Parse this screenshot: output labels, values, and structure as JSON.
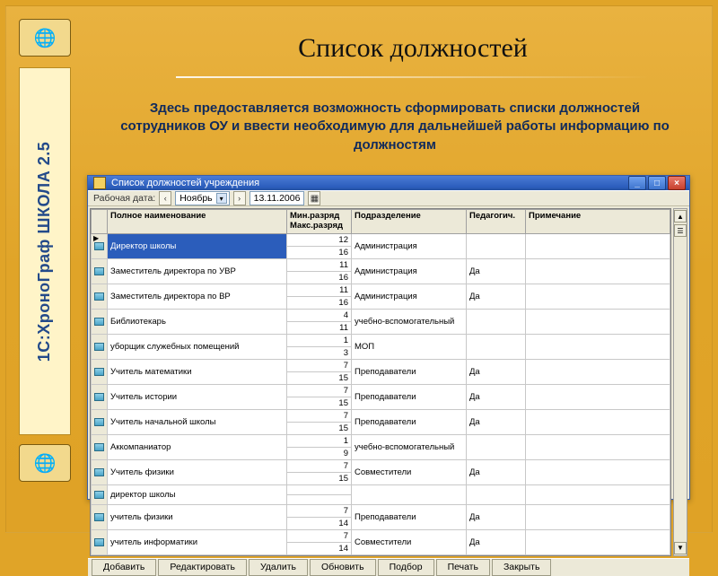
{
  "slide": {
    "title": "Список должностей",
    "description": "Здесь предоставляется возможность сформировать списки должностей сотрудников ОУ и ввести необходимую для дальнейшей работы информацию по должностям",
    "product_vertical": "1С:ХроноГраф ШКОЛА 2.5"
  },
  "app": {
    "window_title": "Список должностей учреждения",
    "toolbar": {
      "work_date_label": "Рабочая дата:",
      "month_value": "Ноябрь",
      "date_value": "13.11.2006"
    },
    "columns": {
      "name": "Полное наименование",
      "rank": "Мин.разряд\nМакс.разряд",
      "dept": "Подразделение",
      "ped": "Педагогич.",
      "note": "Примечание"
    },
    "rows": [
      {
        "name": "Директор школы",
        "min": 12,
        "max": 16,
        "dept": "Администрация",
        "ped": "",
        "selected": true
      },
      {
        "name": "Заместитель директора по УВР",
        "min": 11,
        "max": 16,
        "dept": "Администрация",
        "ped": "Да"
      },
      {
        "name": "Заместитель директора по ВР",
        "min": 11,
        "max": 16,
        "dept": "Администрация",
        "ped": "Да"
      },
      {
        "name": "Библиотекарь",
        "min": 4,
        "max": 11,
        "dept": "учебно-вспомогательный",
        "ped": ""
      },
      {
        "name": "уборщик служебных помещений",
        "min": 1,
        "max": 3,
        "dept": "МОП",
        "ped": ""
      },
      {
        "name": "Учитель математики",
        "min": 7,
        "max": 15,
        "dept": "Преподаватели",
        "ped": "Да"
      },
      {
        "name": "Учитель истории",
        "min": 7,
        "max": 15,
        "dept": "Преподаватели",
        "ped": "Да"
      },
      {
        "name": "Учитель начальной школы",
        "min": 7,
        "max": 15,
        "dept": "Преподаватели",
        "ped": "Да"
      },
      {
        "name": "Аккомпаниатор",
        "min": 1,
        "max": 9,
        "dept": "учебно-вспомогательный",
        "ped": ""
      },
      {
        "name": "Учитель физики",
        "min": 7,
        "max": 15,
        "dept": "Совместители",
        "ped": "Да"
      },
      {
        "name": "директор школы",
        "min": "",
        "max": "",
        "dept": "",
        "ped": ""
      },
      {
        "name": "учитель физики",
        "min": 7,
        "max": 14,
        "dept": "Преподаватели",
        "ped": "Да"
      },
      {
        "name": "учитель информатики",
        "min": 7,
        "max": 14,
        "dept": "Совместители",
        "ped": "Да"
      }
    ],
    "buttons": {
      "add": "Добавить",
      "edit": "Редактировать",
      "delete": "Удалить",
      "refresh": "Обновить",
      "select": "Подбор",
      "print": "Печать",
      "close": "Закрыть"
    }
  },
  "icons": {
    "globe": "🌐"
  }
}
